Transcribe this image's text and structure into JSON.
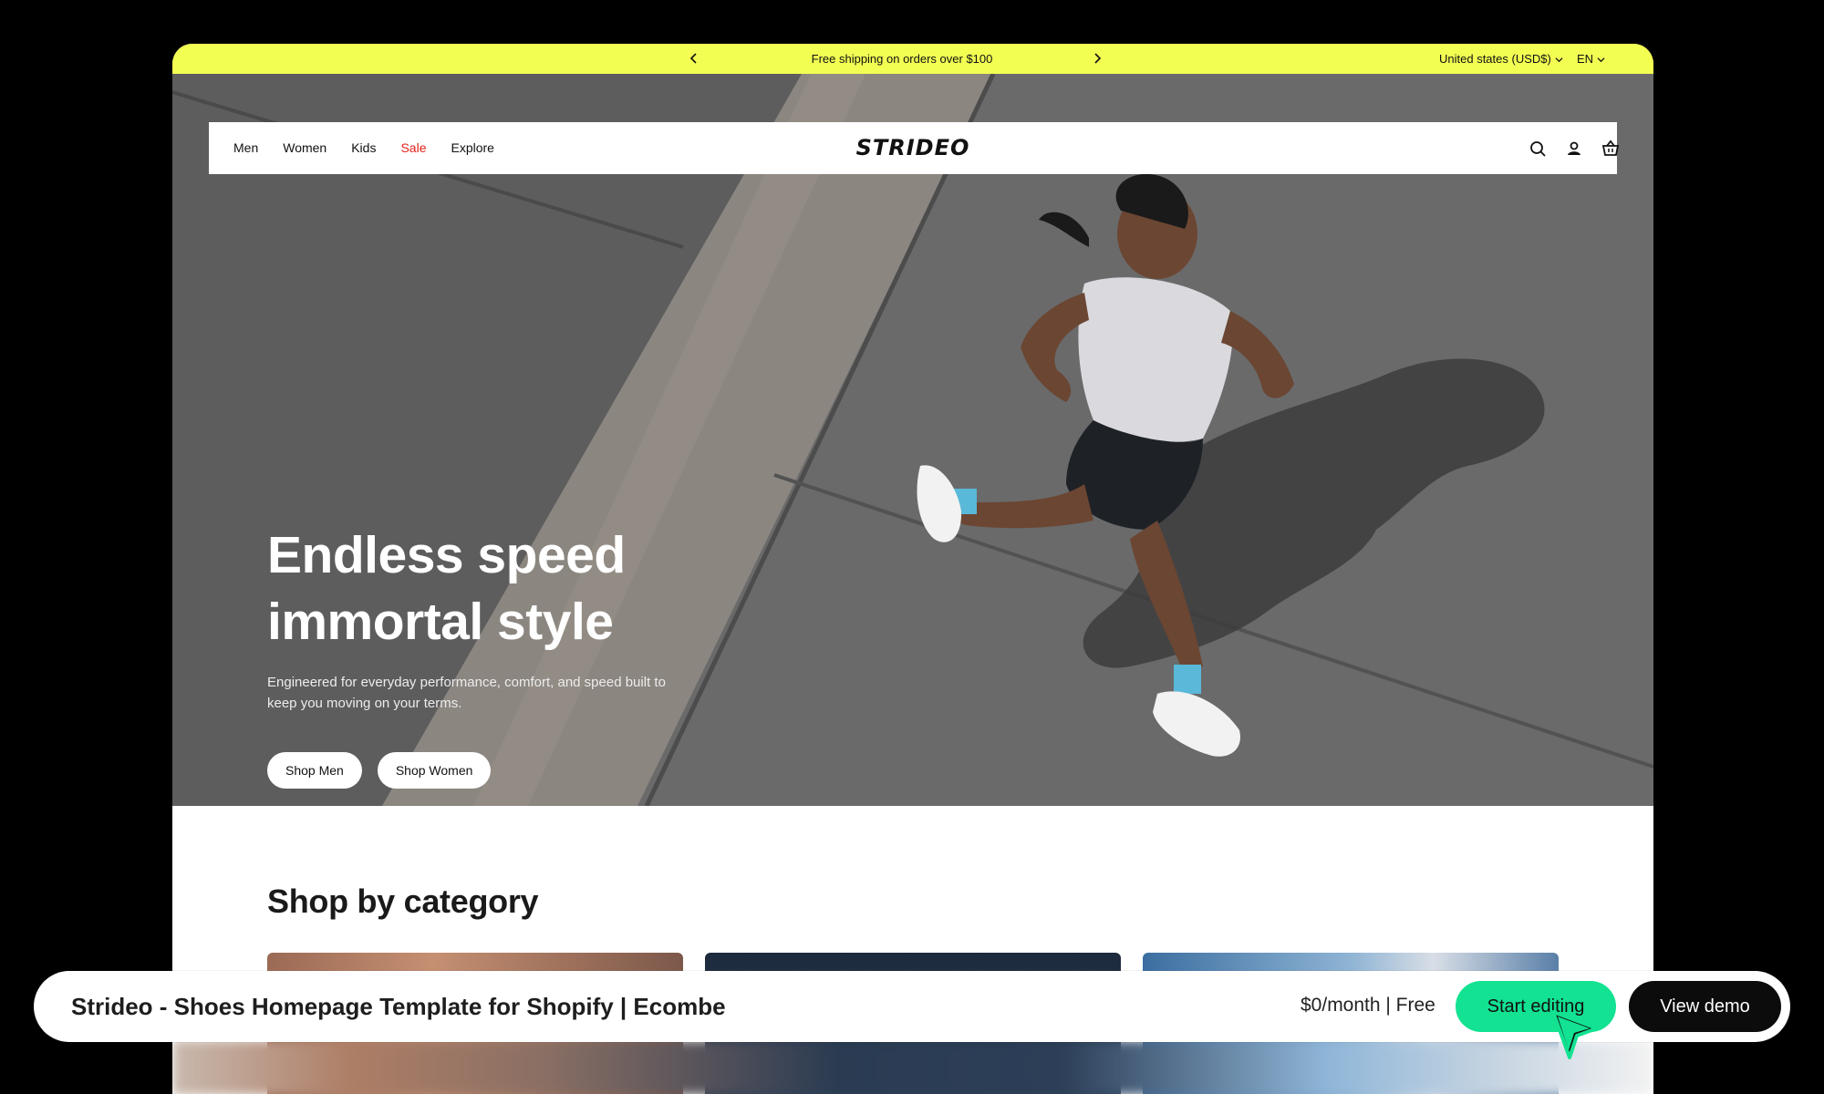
{
  "announcement": {
    "message": "Free shipping on orders over $100",
    "region": "United states (USD$)",
    "language": "EN"
  },
  "nav": {
    "links": [
      "Men",
      "Women",
      "Kids",
      "Sale",
      "Explore"
    ],
    "logo": "STRIDEO",
    "icons": [
      "search-icon",
      "account-icon",
      "cart-icon"
    ],
    "sale_color": "#e2231a"
  },
  "hero": {
    "headline_line1": "Endless speed",
    "headline_line2": "immortal style",
    "subtitle": "Engineered for everyday performance, comfort, and speed built to keep you moving on your terms.",
    "buttons": [
      "Shop Men",
      "Shop Women"
    ]
  },
  "category": {
    "title": "Shop by category"
  },
  "bottom_bar": {
    "title": "Strideo - Shoes Homepage Template for Shopify | Ecombe",
    "price": "$0/month | Free",
    "start_label": "Start editing",
    "demo_label": "View demo",
    "accent": "#12e291"
  },
  "colors": {
    "announcement_bg": "#f2ff52",
    "page_bg": "#000000"
  }
}
